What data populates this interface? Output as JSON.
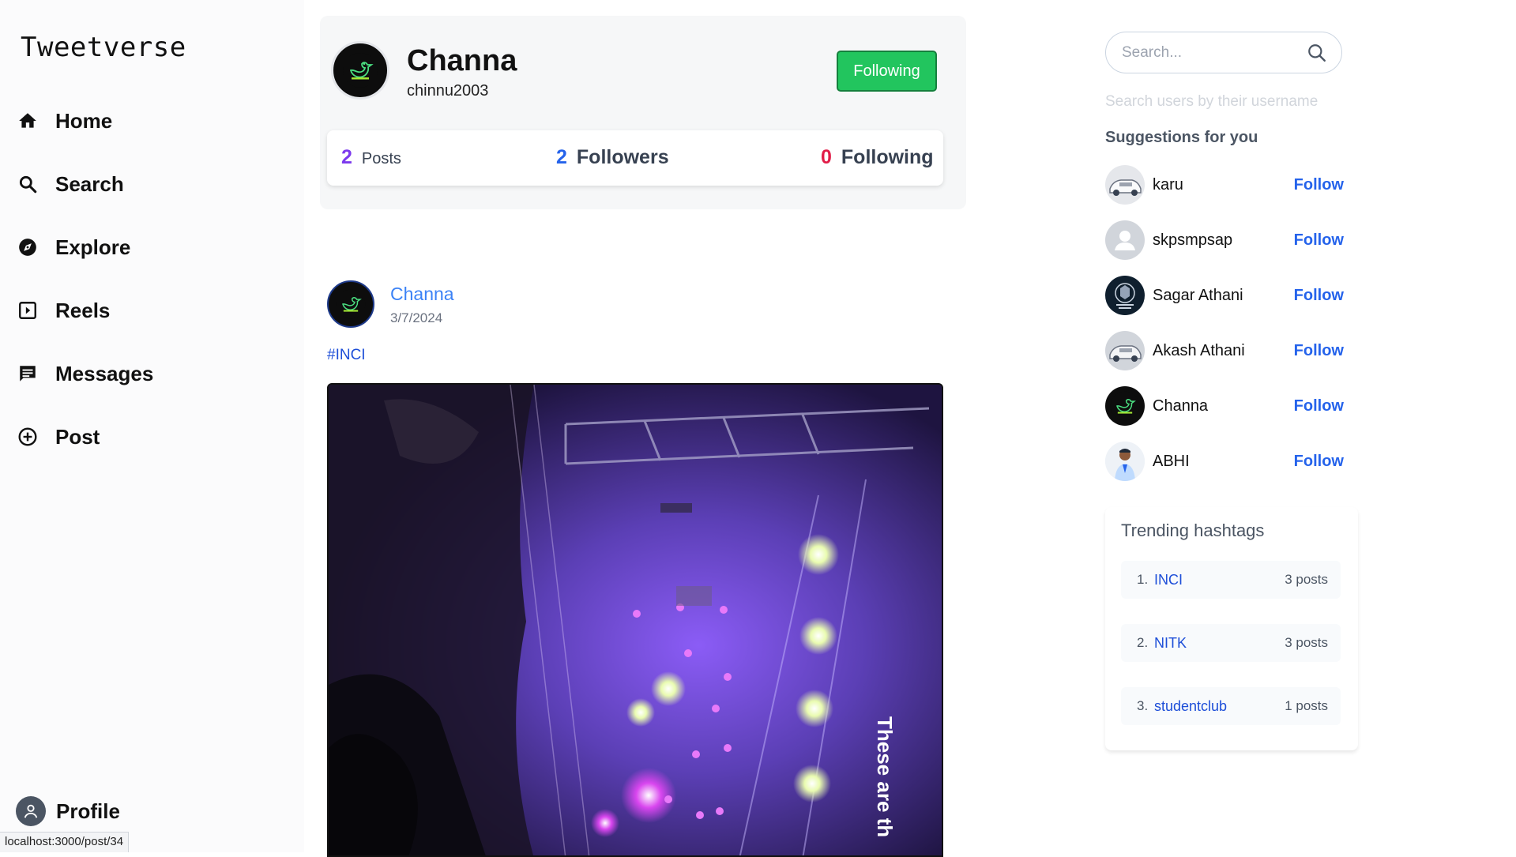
{
  "app": {
    "logo": "Tweetverse"
  },
  "nav": {
    "items": [
      {
        "label": "Home",
        "icon": "home-icon"
      },
      {
        "label": "Search",
        "icon": "search-icon"
      },
      {
        "label": "Explore",
        "icon": "compass-icon"
      },
      {
        "label": "Reels",
        "icon": "play-square-icon"
      },
      {
        "label": "Messages",
        "icon": "message-icon"
      },
      {
        "label": "Post",
        "icon": "plus-circle-icon"
      }
    ],
    "profile_label": "Profile"
  },
  "status_bar": {
    "url": "localhost:3000/post/34"
  },
  "profile": {
    "name": "Channa",
    "username": "chinnu2003",
    "follow_button": "Following",
    "stats": {
      "posts": {
        "count": "2",
        "label": "Posts"
      },
      "followers": {
        "count": "2",
        "label": "Followers"
      },
      "following": {
        "count": "0",
        "label": "Following"
      }
    }
  },
  "post": {
    "author": "Channa",
    "date": "3/7/2024",
    "hashtag": "#INCI",
    "media_overlay_text": "These are th"
  },
  "search": {
    "placeholder": "Search...",
    "hint": "Search users by their username"
  },
  "suggestions": {
    "title": "Suggestions for you",
    "follow_label": "Follow",
    "users": [
      {
        "name": "karu",
        "avatar": "car-photo"
      },
      {
        "name": "skpsmpsap",
        "avatar": "default-user"
      },
      {
        "name": "Sagar Athani",
        "avatar": "crest-logo"
      },
      {
        "name": "Akash Athani",
        "avatar": "car-photo"
      },
      {
        "name": "Channa",
        "avatar": "bird-logo"
      },
      {
        "name": "ABHI",
        "avatar": "person-photo"
      }
    ]
  },
  "trending": {
    "title": "Trending hashtags",
    "items": [
      {
        "rank": "1.",
        "tag": "INCI",
        "count": "3 posts"
      },
      {
        "rank": "2.",
        "tag": "NITK",
        "count": "3 posts"
      },
      {
        "rank": "3.",
        "tag": "studentclub",
        "count": "1 posts"
      }
    ]
  },
  "colors": {
    "accent_blue": "#2563eb",
    "following_green": "#22c55e",
    "posts_count": "#7c3aed",
    "followers_count": "#2563eb",
    "following_count": "#e11d48"
  }
}
